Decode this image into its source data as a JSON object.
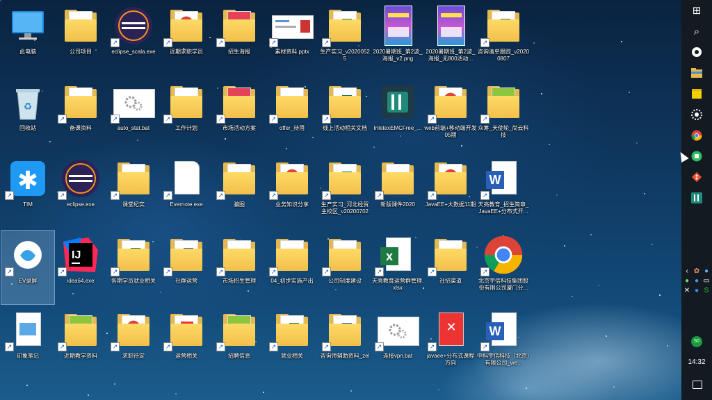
{
  "desktop": {
    "rows": [
      [
        {
          "label": "此电脑",
          "kind": "pc"
        },
        {
          "label": "公司项目",
          "kind": "folder"
        },
        {
          "label": "eclipse_scala.exe",
          "kind": "eclipse",
          "shortcut": true
        },
        {
          "label": "近期求职学员",
          "kind": "folder-chrome",
          "shortcut": true
        },
        {
          "label": "招生海报",
          "kind": "folder-red",
          "shortcut": true
        },
        {
          "label": "素材资料.pptx",
          "kind": "pptx",
          "shortcut": true
        },
        {
          "label": "生产实习_v20200525",
          "kind": "folder-xls",
          "shortcut": true
        },
        {
          "label": "2020暑期班_第2波_海报_v2.png",
          "kind": "poster"
        },
        {
          "label": "2020暑期班_第2波_海报_无800活动...",
          "kind": "poster"
        },
        {
          "label": "咨询清单跟踪_v20200807",
          "kind": "folder-xls",
          "shortcut": true
        }
      ],
      [
        {
          "label": "回收站",
          "kind": "recycle"
        },
        {
          "label": "备课资料",
          "kind": "folder",
          "shortcut": true
        },
        {
          "label": "auto_stat.bat",
          "kind": "bat",
          "shortcut": true
        },
        {
          "label": "工作计划",
          "kind": "folder",
          "shortcut": true
        },
        {
          "label": "市场活动方案",
          "kind": "folder-red",
          "shortcut": true
        },
        {
          "label": "offer_待用",
          "kind": "folder",
          "shortcut": true
        },
        {
          "label": "线上活动相关文档",
          "kind": "folder-xls",
          "shortcut": true
        },
        {
          "label": "InletexEMCFree_...",
          "kind": "inletex"
        },
        {
          "label": "web前端+移动端开发05期",
          "kind": "folder-chrome",
          "shortcut": true
        },
        {
          "label": "众筹_天使轮_尚云科技",
          "kind": "folder-green",
          "shortcut": true
        }
      ],
      [
        {
          "label": "TIM",
          "kind": "tim",
          "shortcut": true
        },
        {
          "label": "eclipse.exe",
          "kind": "eclipse",
          "shortcut": true
        },
        {
          "label": "课堂纪实",
          "kind": "folder",
          "shortcut": true
        },
        {
          "label": "Evernote.exe",
          "kind": "blank",
          "shortcut": true
        },
        {
          "label": "骗图",
          "kind": "folder",
          "shortcut": true
        },
        {
          "label": "业务知识分享",
          "kind": "folder-chrome",
          "shortcut": true
        },
        {
          "label": "生产实习_河北经贸主校区_v20200702",
          "kind": "folder-xls",
          "shortcut": true
        },
        {
          "label": "新版课件2020",
          "kind": "folder",
          "shortcut": true
        },
        {
          "label": "JavaEE+大数据11期",
          "kind": "folder-chrome",
          "shortcut": true
        },
        {
          "label": "天亮教育_招生简章_JavaEE+分布式开...",
          "kind": "word",
          "shortcut": true
        }
      ],
      [
        {
          "label": "EV录屏",
          "kind": "ev",
          "shortcut": true,
          "selected": true
        },
        {
          "label": "idea64.exe",
          "kind": "idea",
          "shortcut": true
        },
        {
          "label": "各期学员就业相关",
          "kind": "folder-xls",
          "shortcut": true
        },
        {
          "label": "社群运营",
          "kind": "folder-word",
          "shortcut": true
        },
        {
          "label": "市场招生管理",
          "kind": "folder",
          "shortcut": true
        },
        {
          "label": "04_初步实施产出",
          "kind": "folder",
          "shortcut": true
        },
        {
          "label": "公司制度建设",
          "kind": "folder",
          "shortcut": true
        },
        {
          "label": "天亮教育运营群管理.xlsx",
          "kind": "excel",
          "shortcut": true
        },
        {
          "label": "社招渠道",
          "kind": "folder",
          "shortcut": true
        },
        {
          "label": "北京宇信科技集团股份有限公司厦门分...",
          "kind": "chrome",
          "shortcut": true
        }
      ],
      [
        {
          "label": "印象笔记",
          "kind": "yinxiang",
          "shortcut": true
        },
        {
          "label": "近期教学资料",
          "kind": "folder-green",
          "shortcut": true
        },
        {
          "label": "求职待定",
          "kind": "folder-chrome",
          "shortcut": true
        },
        {
          "label": "运营相关",
          "kind": "folder-xmind",
          "shortcut": true
        },
        {
          "label": "招聘信息",
          "kind": "folder-green",
          "shortcut": true
        },
        {
          "label": "就业相关",
          "kind": "folder-xls",
          "shortcut": true
        },
        {
          "label": "咨询师辅助资料_zel",
          "kind": "folder-word",
          "shortcut": true
        },
        {
          "label": "连接vpn.bat",
          "kind": "bat",
          "shortcut": true
        },
        {
          "label": "javaee+分布式课程方向",
          "kind": "xmind",
          "shortcut": true
        },
        {
          "label": "中科宇信科技（北京）有限公司_we...",
          "kind": "word",
          "shortcut": true
        }
      ]
    ]
  },
  "taskbar": {
    "start_icon": "⊞",
    "search_icon": "⌕",
    "pinned": [
      "app-flower",
      "explorer",
      "sticky-notes",
      "settings-gear",
      "chrome",
      "evernote",
      "git",
      "inletex"
    ],
    "clock": "14:32"
  }
}
